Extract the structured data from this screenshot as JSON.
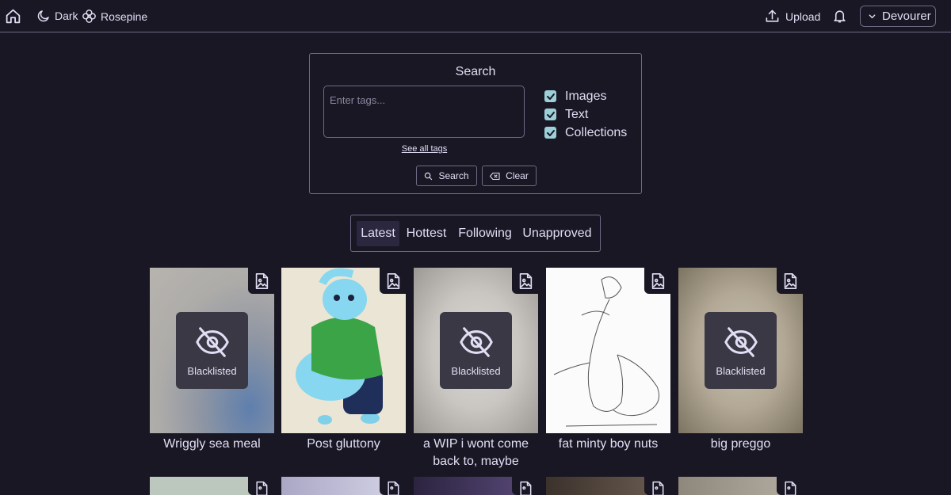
{
  "nav": {
    "theme_label": "Dark",
    "palette_label": "Rosepine",
    "upload_label": "Upload",
    "user_label": "Devourer"
  },
  "search": {
    "title": "Search",
    "placeholder": "Enter tags...",
    "see_all_tags": "See all tags",
    "options": [
      {
        "label": "Images",
        "checked": true
      },
      {
        "label": "Text",
        "checked": true
      },
      {
        "label": "Collections",
        "checked": true
      }
    ],
    "search_button": "Search",
    "clear_button": "Clear"
  },
  "tabs": [
    {
      "label": "Latest",
      "active": true
    },
    {
      "label": "Hottest",
      "active": false
    },
    {
      "label": "Following",
      "active": false
    },
    {
      "label": "Unapproved",
      "active": false
    }
  ],
  "posts": [
    {
      "title": "Wriggly sea meal",
      "blacklisted": true,
      "blacklisted_label": "Blacklisted"
    },
    {
      "title": "Post gluttony",
      "blacklisted": false
    },
    {
      "title": "a WIP i wont come back to, maybe",
      "blacklisted": true,
      "blacklisted_label": "Blacklisted"
    },
    {
      "title": "fat minty boy nuts",
      "blacklisted": false
    },
    {
      "title": "big preggo",
      "blacklisted": true,
      "blacklisted_label": "Blacklisted"
    }
  ],
  "colors": {
    "background": "#191724",
    "text": "#e0def4",
    "border": "#6e6a86",
    "checkbox": "#9ccfd8"
  }
}
